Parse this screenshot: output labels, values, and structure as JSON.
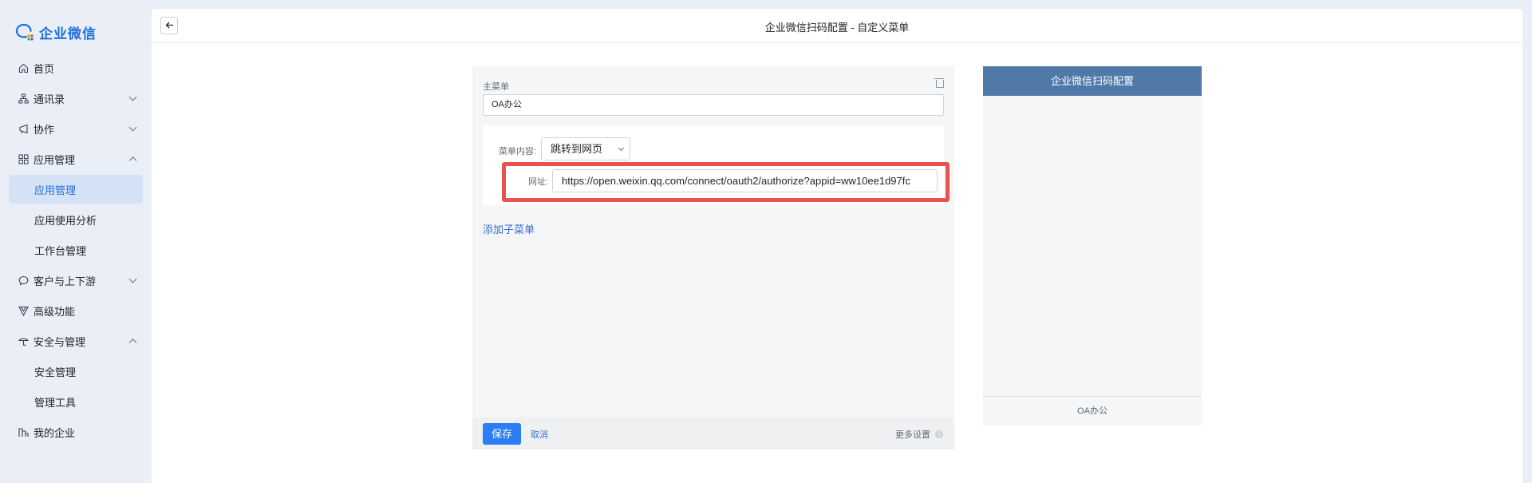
{
  "app": {
    "logo_text": "企业微信"
  },
  "sidebar": {
    "items": [
      {
        "label": "首页",
        "icon": "home-icon"
      },
      {
        "label": "通讯录",
        "icon": "org-icon",
        "expand": "down"
      },
      {
        "label": "协作",
        "icon": "collab-icon",
        "expand": "down"
      },
      {
        "label": "应用管理",
        "icon": "apps-icon",
        "expand": "up"
      },
      {
        "label": "应用管理",
        "sub": true,
        "active": true
      },
      {
        "label": "应用使用分析",
        "sub": true
      },
      {
        "label": "工作台管理",
        "sub": true
      },
      {
        "label": "客户与上下游",
        "icon": "chat-icon",
        "expand": "down"
      },
      {
        "label": "高级功能",
        "icon": "advanced-icon"
      },
      {
        "label": "安全与管理",
        "icon": "security-icon",
        "expand": "up"
      },
      {
        "label": "安全管理",
        "sub": true
      },
      {
        "label": "管理工具",
        "sub": true
      },
      {
        "label": "我的企业",
        "icon": "company-icon"
      }
    ]
  },
  "header": {
    "title": "企业微信扫码配置 - 自定义菜单",
    "back_icon": "arrow-left-icon"
  },
  "editor": {
    "main_menu_label": "主菜单",
    "main_menu_value": "OA办公",
    "content_label": "菜单内容:",
    "content_value": "跳转到网页",
    "url_label": "网址:",
    "url_value": "https://open.weixin.qq.com/connect/oauth2/authorize?appid=ww10ee1d97fc",
    "add_submenu": "添加子菜单",
    "save": "保存",
    "cancel": "取消",
    "more_settings": "更多设置",
    "highlight_color": "#e8534f"
  },
  "preview": {
    "header": "企业微信扫码配置",
    "footer_menu": "OA办公",
    "header_color": "#5079a8"
  }
}
